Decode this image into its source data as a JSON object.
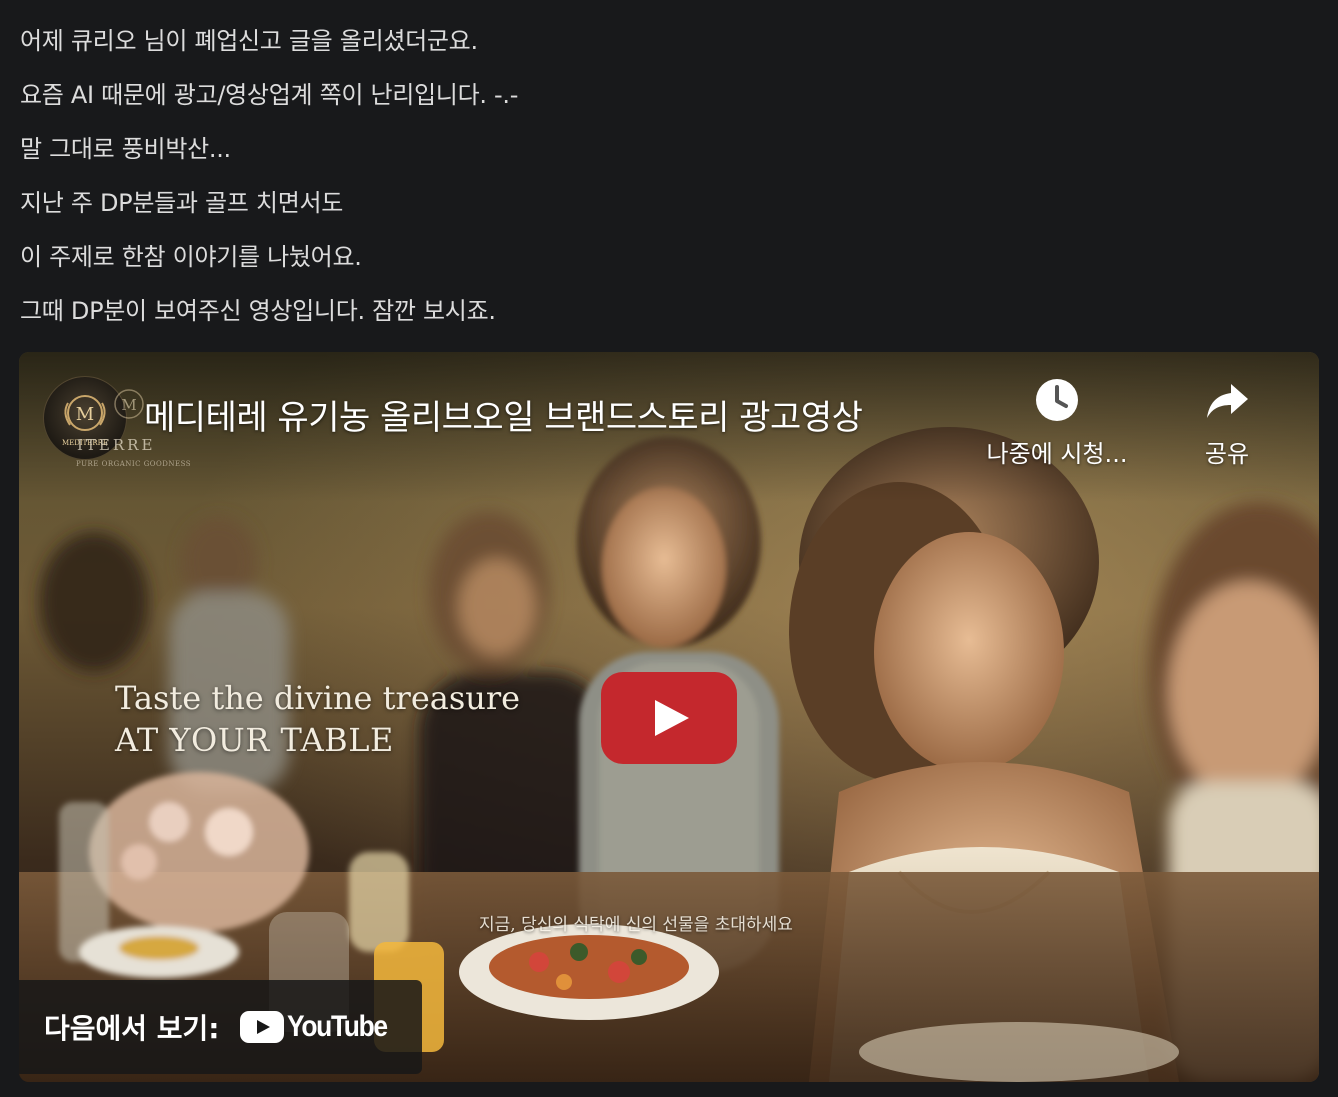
{
  "post": {
    "lines": [
      "어제 큐리오 님이 폐업신고 글을 올리셨더군요.",
      "요즘 AI 때문에 광고/영상업계 쪽이 난리입니다. -.-",
      "말 그대로 풍비박산...",
      "지난 주 DP분들과 골프 치면서도",
      "이 주제로 한참 이야기를 나눴어요.",
      "그때 DP분이 보여주신 영상입니다. 잠깐 보시죠."
    ]
  },
  "video": {
    "title": "메디테레 유기농 올리브오일 브랜드스토리 광고영상",
    "channel": {
      "avatar_icon": "mediterre-logo-icon",
      "avatar_text": "MEDITERRE",
      "brand_text": "ITERRE",
      "brand_sub": "PURE ORGANIC GOODNESS"
    },
    "watch_later_label": "나중에 시청...",
    "share_label": "공유",
    "overlay": {
      "line1": "Taste the divine treasure",
      "line2": "AT YOUR TABLE"
    },
    "subtitle": "지금, 당신의 식탁에 신의 선물을 초대하세요",
    "watch_on_label": "다음에서 보기:",
    "youtube_wordmark": "YouTube",
    "play_button_color": "#c4282d",
    "icons": {
      "watch_later": "clock-icon",
      "share": "share-arrow-icon",
      "play": "play-icon",
      "youtube": "youtube-logo-icon"
    }
  }
}
